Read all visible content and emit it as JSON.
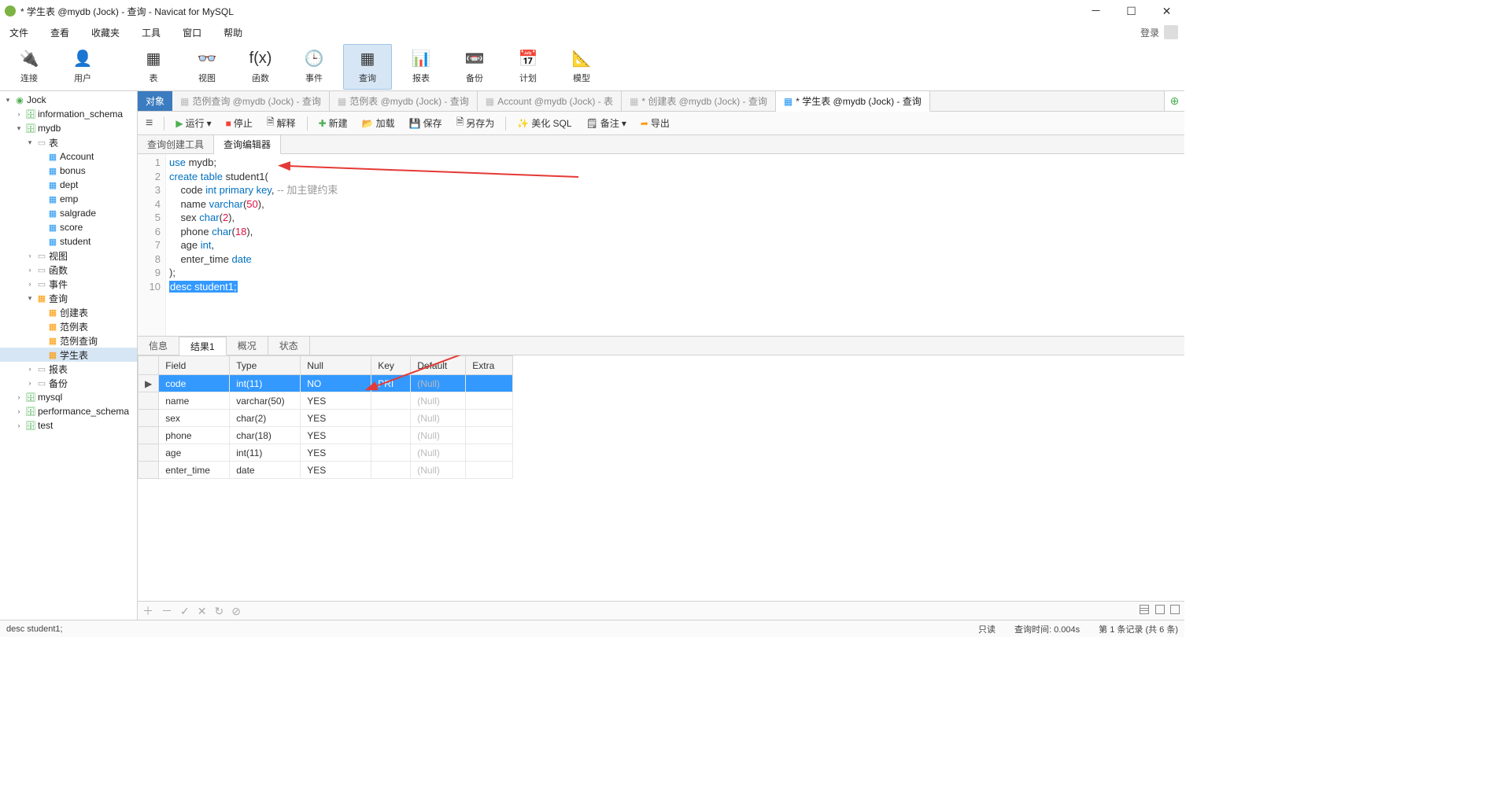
{
  "titlebar": {
    "title": "* 学生表 @mydb (Jock) - 查询 - Navicat for MySQL"
  },
  "menubar": {
    "items": [
      "文件",
      "查看",
      "收藏夹",
      "工具",
      "窗口",
      "帮助"
    ],
    "login": "登录"
  },
  "toolbar": [
    {
      "label": "连接",
      "icon": "🔌"
    },
    {
      "label": "用户",
      "icon": "👤"
    },
    {
      "label": "表",
      "icon": "▦"
    },
    {
      "label": "视图",
      "icon": "👓"
    },
    {
      "label": "函数",
      "icon": "f(x)"
    },
    {
      "label": "事件",
      "icon": "🕒"
    },
    {
      "label": "查询",
      "icon": "▦",
      "active": true
    },
    {
      "label": "报表",
      "icon": "📊"
    },
    {
      "label": "备份",
      "icon": "📼"
    },
    {
      "label": "计划",
      "icon": "📅"
    },
    {
      "label": "模型",
      "icon": "📐"
    }
  ],
  "tree": [
    {
      "d": 0,
      "tw": "▾",
      "ic": "conn",
      "lbl": "Jock"
    },
    {
      "d": 1,
      "tw": "›",
      "ic": "db",
      "lbl": "information_schema"
    },
    {
      "d": 1,
      "tw": "▾",
      "ic": "db",
      "lbl": "mydb"
    },
    {
      "d": 2,
      "tw": "▾",
      "ic": "fld",
      "lbl": "表"
    },
    {
      "d": 3,
      "tw": "",
      "ic": "tbl",
      "lbl": "Account"
    },
    {
      "d": 3,
      "tw": "",
      "ic": "tbl",
      "lbl": "bonus"
    },
    {
      "d": 3,
      "tw": "",
      "ic": "tbl",
      "lbl": "dept"
    },
    {
      "d": 3,
      "tw": "",
      "ic": "tbl",
      "lbl": "emp"
    },
    {
      "d": 3,
      "tw": "",
      "ic": "tbl",
      "lbl": "salgrade"
    },
    {
      "d": 3,
      "tw": "",
      "ic": "tbl",
      "lbl": "score"
    },
    {
      "d": 3,
      "tw": "",
      "ic": "tbl",
      "lbl": "student"
    },
    {
      "d": 2,
      "tw": "›",
      "ic": "fld",
      "lbl": "视图"
    },
    {
      "d": 2,
      "tw": "›",
      "ic": "fld",
      "lbl": "函数"
    },
    {
      "d": 2,
      "tw": "›",
      "ic": "fld",
      "lbl": "事件"
    },
    {
      "d": 2,
      "tw": "▾",
      "ic": "qry",
      "lbl": "查询"
    },
    {
      "d": 3,
      "tw": "",
      "ic": "qry",
      "lbl": "创建表"
    },
    {
      "d": 3,
      "tw": "",
      "ic": "qry",
      "lbl": "范例表"
    },
    {
      "d": 3,
      "tw": "",
      "ic": "qry",
      "lbl": "范例查询"
    },
    {
      "d": 3,
      "tw": "",
      "ic": "qry",
      "lbl": "学生表",
      "sel": true
    },
    {
      "d": 2,
      "tw": "›",
      "ic": "fld",
      "lbl": "报表"
    },
    {
      "d": 2,
      "tw": "›",
      "ic": "fld",
      "lbl": "备份"
    },
    {
      "d": 1,
      "tw": "›",
      "ic": "db",
      "lbl": "mysql"
    },
    {
      "d": 1,
      "tw": "›",
      "ic": "db",
      "lbl": "performance_schema"
    },
    {
      "d": 1,
      "tw": "›",
      "ic": "db",
      "lbl": "test"
    }
  ],
  "doctabs": {
    "obj": "对象",
    "tabs": [
      {
        "lbl": "范例查询 @mydb (Jock) - 查询"
      },
      {
        "lbl": "范例表 @mydb (Jock) - 查询"
      },
      {
        "lbl": "Account @mydb (Jock) - 表"
      },
      {
        "lbl": "* 创建表 @mydb (Jock) - 查询"
      },
      {
        "lbl": "* 学生表 @mydb (Jock) - 查询",
        "active": true
      }
    ]
  },
  "qtoolbar": {
    "run": "运行",
    "stop": "停止",
    "explain": "解释",
    "new": "新建",
    "load": "加载",
    "save": "保存",
    "saveas": "另存为",
    "beautify": "美化 SQL",
    "note": "备注",
    "export": "导出"
  },
  "subtabs": {
    "a": "查询创建工具",
    "b": "查询编辑器"
  },
  "code": {
    "lines": [
      {
        "n": "1",
        "html": "<span class='kw'>use</span> mydb;"
      },
      {
        "n": "2",
        "html": "<span class='kw'>create</span> <span class='kw'>table</span> student1("
      },
      {
        "n": "3",
        "html": "    code <span class='kw'>int</span> <span class='kw'>primary</span> <span class='kw'>key</span>, <span class='cmt'>-- 加主键约束</span>"
      },
      {
        "n": "4",
        "html": "    name <span class='kw'>varchar</span>(<span class='num'>50</span>),"
      },
      {
        "n": "5",
        "html": "    sex <span class='kw'>char</span>(<span class='num'>2</span>),"
      },
      {
        "n": "6",
        "html": "    phone <span class='kw'>char</span>(<span class='num'>18</span>),"
      },
      {
        "n": "7",
        "html": "    age <span class='kw'>int</span>,"
      },
      {
        "n": "8",
        "html": "    enter_time <span class='kw'>date</span>"
      },
      {
        "n": "9",
        "html": ");"
      },
      {
        "n": "10",
        "html": "<span class='sel'>desc student1;</span>"
      }
    ]
  },
  "restabs": [
    "信息",
    "结果1",
    "概况",
    "状态"
  ],
  "grid": {
    "cols": [
      "Field",
      "Type",
      "Null",
      "Key",
      "Default",
      "Extra"
    ],
    "widths": [
      90,
      90,
      90,
      50,
      70,
      60
    ],
    "rows": [
      {
        "ptr": "▶",
        "c": [
          "code",
          "int(11)",
          "NO",
          "PRI",
          "(Null)",
          ""
        ],
        "sel": true
      },
      {
        "ptr": "",
        "c": [
          "name",
          "varchar(50)",
          "YES",
          "",
          "(Null)",
          ""
        ]
      },
      {
        "ptr": "",
        "c": [
          "sex",
          "char(2)",
          "YES",
          "",
          "(Null)",
          ""
        ]
      },
      {
        "ptr": "",
        "c": [
          "phone",
          "char(18)",
          "YES",
          "",
          "(Null)",
          ""
        ]
      },
      {
        "ptr": "",
        "c": [
          "age",
          "int(11)",
          "YES",
          "",
          "(Null)",
          ""
        ]
      },
      {
        "ptr": "",
        "c": [
          "enter_time",
          "date",
          "YES",
          "",
          "(Null)",
          ""
        ]
      }
    ]
  },
  "gridbar": {
    "icons": [
      "＋",
      "－",
      "✓",
      "✕",
      "↻",
      "⊘"
    ]
  },
  "statusbar": {
    "left": "desc student1;",
    "readonly": "只读",
    "time": "查询时间: 0.004s",
    "rec": "第 1 条记录 (共 6 条)"
  }
}
